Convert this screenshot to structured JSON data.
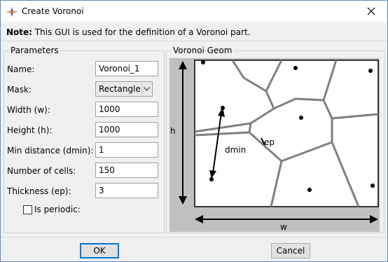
{
  "window": {
    "title": "Create Voronoi"
  },
  "note": {
    "label": "Note:",
    "text": "This GUI is used for the definition of a Voronoi part."
  },
  "parameters": {
    "legend": "Parameters",
    "name": {
      "label": "Name:",
      "value": "Voronoi_1"
    },
    "mask": {
      "label": "Mask:",
      "value": "Rectangle"
    },
    "width": {
      "label": "Width (w):",
      "value": "1000"
    },
    "height": {
      "label": "Height (h):",
      "value": "1000"
    },
    "min_distance": {
      "label": "Min distance (dmin):",
      "value": "1"
    },
    "num_cells": {
      "label": "Number of cells:",
      "value": "150"
    },
    "thickness": {
      "label": "Thickness (ep):",
      "value": "3"
    },
    "periodic": {
      "label": "Is periodic:",
      "checked": false
    }
  },
  "geom": {
    "legend": "Voronoi Geom",
    "label_h": "h",
    "label_w": "w",
    "label_dmin": "dmin",
    "label_ep": "ep"
  },
  "buttons": {
    "ok": "OK",
    "cancel": "Cancel"
  },
  "icons": {
    "app": "voronoi-app-icon",
    "close": "close-icon",
    "dropdown": "chevron-down-icon"
  }
}
